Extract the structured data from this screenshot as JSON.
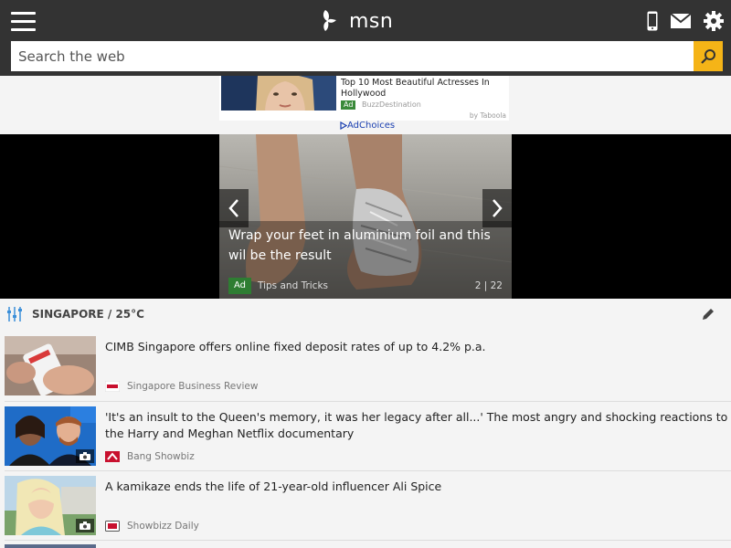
{
  "header": {
    "brand": "msn",
    "icons": [
      "menu-icon",
      "butterfly-logo-icon",
      "phone-icon",
      "mail-icon",
      "gear-icon"
    ]
  },
  "search": {
    "placeholder": "Search the web"
  },
  "ad": {
    "title": "Top 10 Most Beautiful Actresses In Hollywood",
    "badge": "Ad",
    "source": "BuzzDestination",
    "by": "by Taboola",
    "adchoices": "AdChoices"
  },
  "hero": {
    "title": "Wrap your feet in aluminium foil and this wil be the result",
    "badge": "Ad",
    "source": "Tips and Tricks",
    "counter": "2 | 22"
  },
  "section": {
    "label": "SINGAPORE / 25°C"
  },
  "news": [
    {
      "headline": "CIMB Singapore offers online fixed deposit rates of up to 4.2% p.a.",
      "source": "Singapore Business Review"
    },
    {
      "headline": "'It's an insult to the Queen's memory, it was her legacy after all...' The most angry and shocking reactions to the Harry and Meghan Netflix documentary",
      "source": "Bang Showbiz"
    },
    {
      "headline": "A kamikaze ends the life of 21-year-old influencer Ali Spice",
      "source": "Showbizz Daily"
    }
  ],
  "colors": {
    "topbar": "#333333",
    "search_button": "#f5b417",
    "ad_badge": "#2e7d32",
    "link": "#1a3fb0"
  }
}
